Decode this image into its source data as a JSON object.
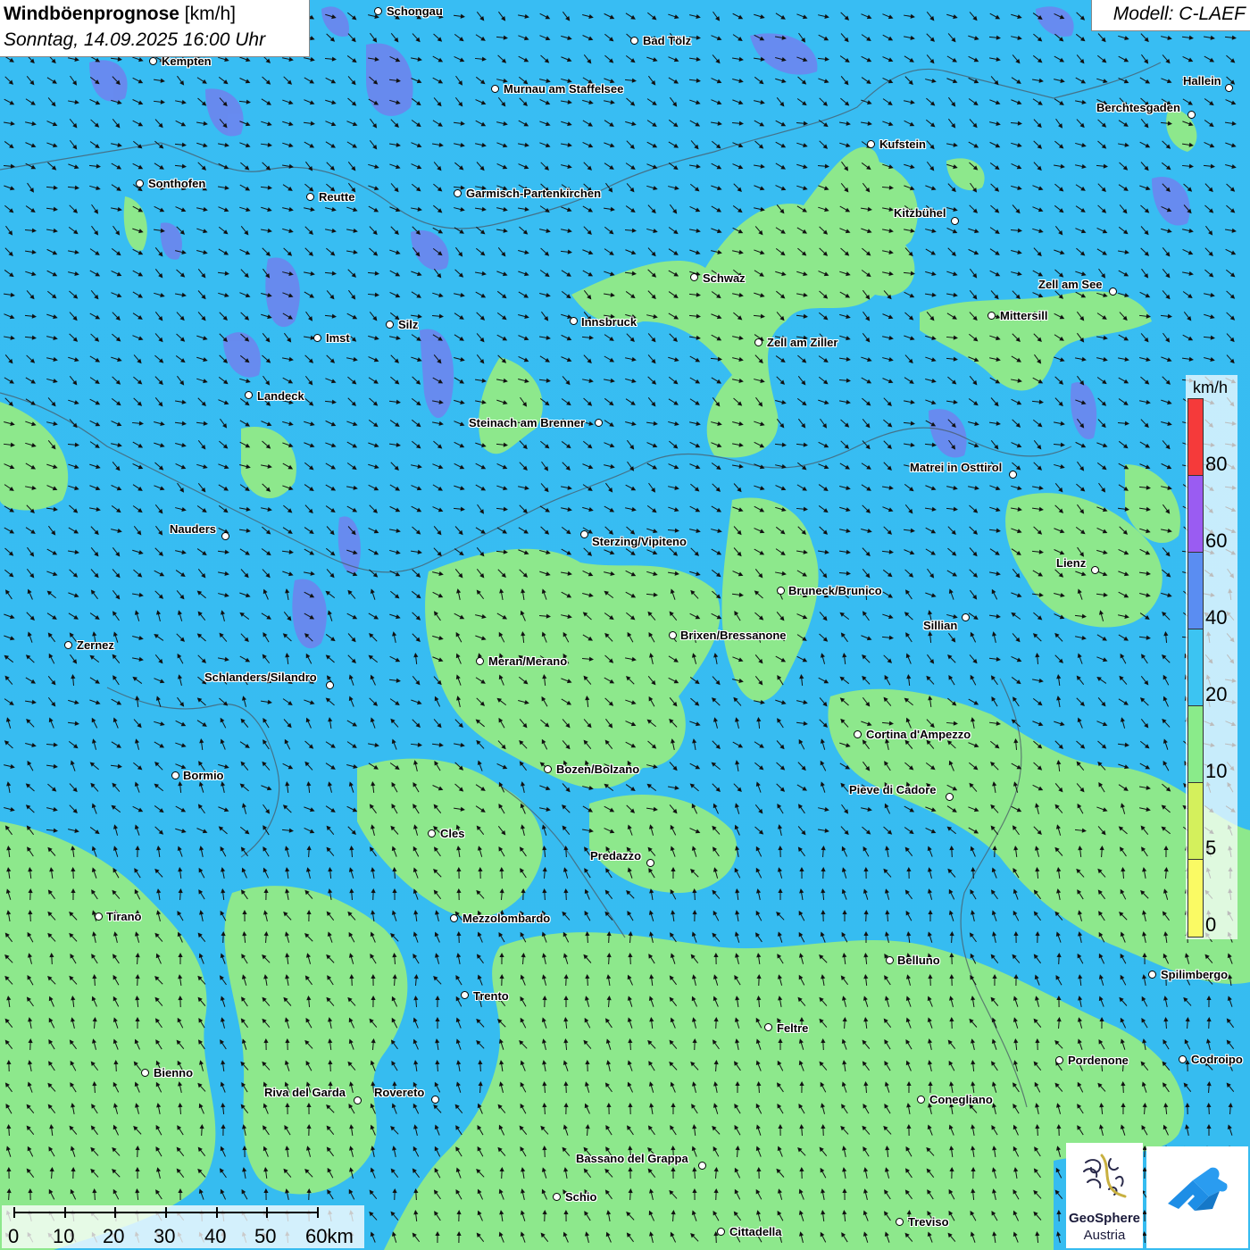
{
  "title": {
    "bold": "Windböenprognose",
    "unit": " [km/h]",
    "subtitle": "Sonntag, 14.09.2025 16:00 Uhr"
  },
  "model_label": "Modell: C-LAEF",
  "legend": {
    "unit": "km/h",
    "ticks": [
      "80",
      "60",
      "40",
      "20",
      "10",
      "5",
      "0"
    ],
    "bands": [
      {
        "from": 80,
        "color": "#f53a3a"
      },
      {
        "from": 60,
        "color": "#9a5cf2"
      },
      {
        "from": 40,
        "color": "#5a8df2"
      },
      {
        "from": 20,
        "color": "#3cc4f2"
      },
      {
        "from": 10,
        "color": "#8aeb8a"
      },
      {
        "from": 5,
        "color": "#d4f05c"
      },
      {
        "from": 0,
        "color": "#fafa64"
      }
    ]
  },
  "scale_bar": {
    "labels": [
      "0",
      "10",
      "20",
      "30",
      "40",
      "50",
      "60km"
    ]
  },
  "cities": [
    "Schongau",
    "Kempten",
    "Bad Tölz",
    "Murnau am Staffelsee",
    "Hallein",
    "Berchtesgaden",
    "Kufstein",
    "Sonthofen",
    "Reutte",
    "Garmisch-Partenkirchen",
    "Kitzbühel",
    "Schwaz",
    "Zell am See",
    "Mittersill",
    "Innsbruck",
    "Silz",
    "Imst",
    "Zell am Ziller",
    "Landeck",
    "Steinach am Brenner",
    "Matrei in Osttirol",
    "Nauders",
    "Sterzing/Vipiteno",
    "Lienz",
    "Bruneck/Brunico",
    "Sillian",
    "Brixen/Bressanone",
    "Zernez",
    "Meran/Merano",
    "Schlanders/Silandro",
    "Cortina d'Ampezzo",
    "Bozen/Bolzano",
    "Bormio",
    "Pieve di Cadore",
    "Cles",
    "Predazzo",
    "Tirano",
    "Mezzolombardo",
    "Belluno",
    "Spilimbergo",
    "Trento",
    "Feltre",
    "Pordenone",
    "Codroipo",
    "Bienno",
    "Riva del Garda",
    "Rovereto",
    "Conegliano",
    "Bassano del Grappa",
    "Schio",
    "Treviso",
    "Cittadella"
  ],
  "logos": {
    "geosphere_line1": "GeoSphere",
    "geosphere_line2": "Austria"
  },
  "wind_direction": "south-east to north-west",
  "colors": {
    "sea_blue": "#37bdf2",
    "green": "#8aeb8a",
    "purple": "#6f7df0"
  }
}
